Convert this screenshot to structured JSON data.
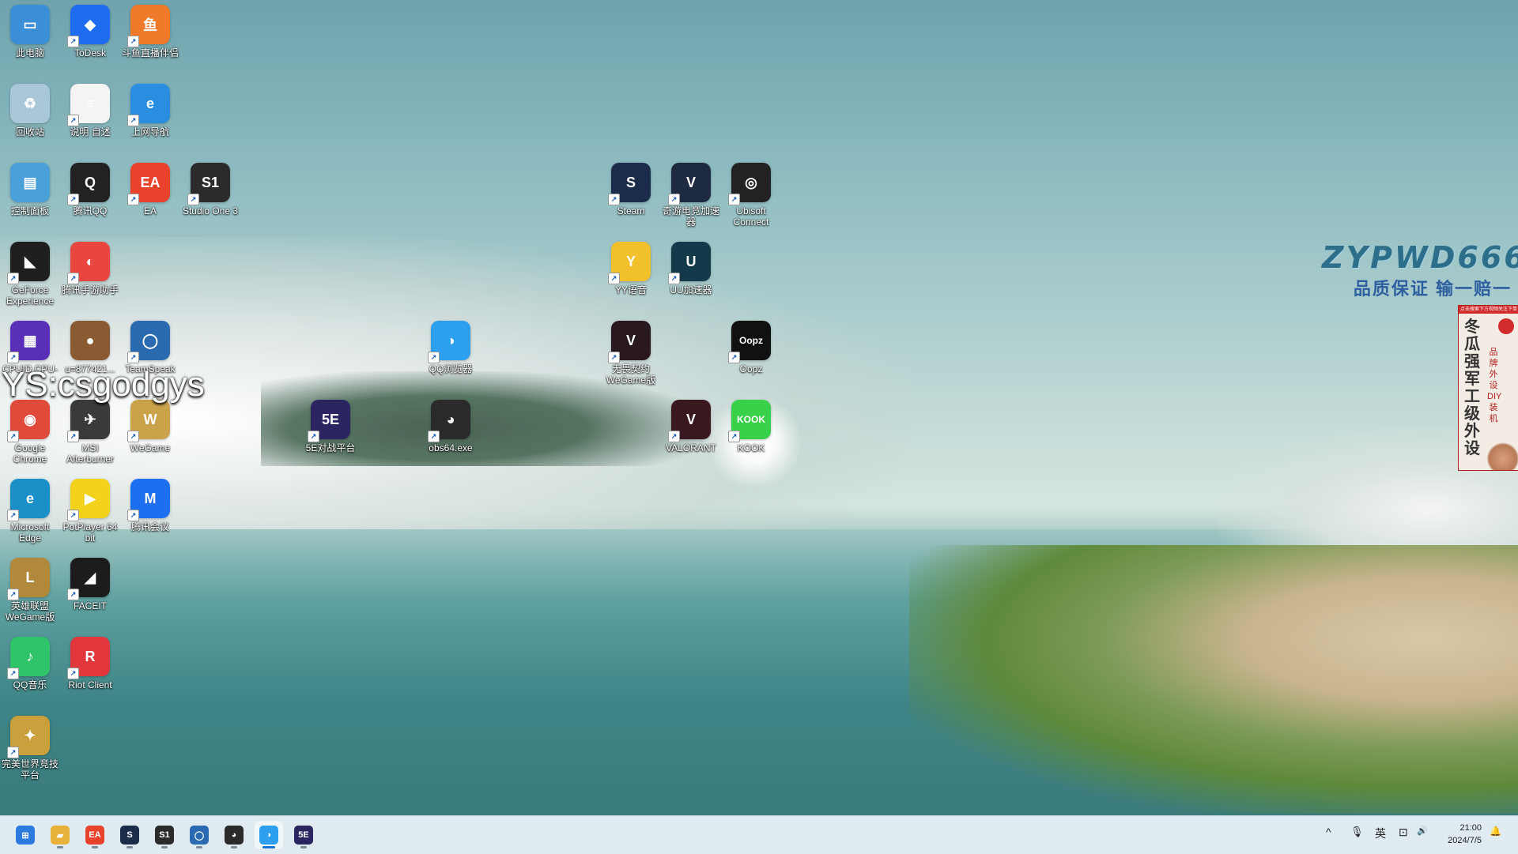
{
  "desktop": {
    "icons": [
      {
        "id": "this-pc",
        "label": "此电脑",
        "glyph": "▭",
        "bg": "#3a8fd6",
        "shortcut": false
      },
      {
        "id": "todesk",
        "label": "ToDesk",
        "glyph": "◆",
        "bg": "#1e6cf0",
        "shortcut": true
      },
      {
        "id": "douyu-assistant",
        "label": "斗鱼直播伴侣",
        "glyph": "鱼",
        "bg": "#f07a2a",
        "shortcut": true
      },
      {
        "id": "recycle-bin",
        "label": "回收站",
        "glyph": "♻",
        "bg": "#a9c7d8",
        "shortcut": false
      },
      {
        "id": "readme",
        "label": "说明 自述",
        "glyph": "≡",
        "bg": "#f4f4f4",
        "shortcut": true
      },
      {
        "id": "web-navigation",
        "label": "上网导航",
        "glyph": "e",
        "bg": "#2a8ee0",
        "shortcut": true
      },
      {
        "id": "control-panel",
        "label": "控制面板",
        "glyph": "▤",
        "bg": "#4aa0d8",
        "shortcut": false
      },
      {
        "id": "tencent-qq",
        "label": "腾讯QQ",
        "glyph": "Q",
        "bg": "#222222",
        "shortcut": true
      },
      {
        "id": "ea",
        "label": "EA",
        "glyph": "EA",
        "bg": "#e8412c",
        "shortcut": true
      },
      {
        "id": "studio-one",
        "label": "Studio One 3",
        "glyph": "S1",
        "bg": "#2b2b2b",
        "shortcut": true
      },
      {
        "id": "geforce-experience",
        "label": "GeForce Experience",
        "glyph": "◣",
        "bg": "#1f1f1f",
        "shortcut": true
      },
      {
        "id": "tencent-mobile-assistant",
        "label": "腾讯手游助手",
        "glyph": "◐",
        "bg": "#e94640",
        "shortcut": true
      },
      {
        "id": "cpuid",
        "label": "CPUID CPU-Z",
        "glyph": "▦",
        "bg": "#5a2fb8",
        "shortcut": true
      },
      {
        "id": "u-file",
        "label": "u=877421...",
        "glyph": "●",
        "bg": "#8a5a32",
        "shortcut": false
      },
      {
        "id": "teamspeak",
        "label": "TeamSpeak",
        "glyph": "◯",
        "bg": "#2a6ab0",
        "shortcut": true
      },
      {
        "id": "google-chrome",
        "label": "Google Chrome",
        "glyph": "◉",
        "bg": "#e04a3a",
        "shortcut": true
      },
      {
        "id": "msi-afterburner",
        "label": "MSI Afterburner",
        "glyph": "✈",
        "bg": "#3a3a3a",
        "shortcut": true
      },
      {
        "id": "wegame",
        "label": "WeGame",
        "glyph": "W",
        "bg": "#c9a24a",
        "shortcut": true
      },
      {
        "id": "microsoft-edge",
        "label": "Microsoft Edge",
        "glyph": "e",
        "bg": "#1a8fc8",
        "shortcut": true
      },
      {
        "id": "potplayer",
        "label": "PotPlayer 64 bit",
        "glyph": "▶",
        "bg": "#f2d21a",
        "shortcut": true
      },
      {
        "id": "tencent-meeting",
        "label": "腾讯会议",
        "glyph": "M",
        "bg": "#1d6ff0",
        "shortcut": true
      },
      {
        "id": "league-wegame",
        "label": "英雄联盟WeGame版",
        "glyph": "L",
        "bg": "#b08a3a",
        "shortcut": true
      },
      {
        "id": "faceit",
        "label": "FACEIT",
        "glyph": "◢",
        "bg": "#1c1c1c",
        "shortcut": true
      },
      {
        "id": "qq-music",
        "label": "QQ音乐",
        "glyph": "♪",
        "bg": "#2fc36a",
        "shortcut": true
      },
      {
        "id": "riot-client",
        "label": "Riot Client",
        "glyph": "R",
        "bg": "#e0363c",
        "shortcut": true
      },
      {
        "id": "perfect-world",
        "label": "完美世界竞技平台",
        "glyph": "✦",
        "bg": "#c9a03c",
        "shortcut": true
      },
      {
        "id": "qq-browser",
        "label": "QQ浏览器",
        "glyph": "◑",
        "bg": "#2ca0ee",
        "shortcut": true
      },
      {
        "id": "5e-platform",
        "label": "5E对战平台",
        "glyph": "5E",
        "bg": "#2a2560",
        "shortcut": true
      },
      {
        "id": "obs",
        "label": "obs64.exe",
        "glyph": "◕",
        "bg": "#2a2a2a",
        "shortcut": true
      },
      {
        "id": "steam",
        "label": "Steam",
        "glyph": "S",
        "bg": "#1a2c4a",
        "shortcut": true
      },
      {
        "id": "qiyou-accelerator",
        "label": "奇游电竞加速器",
        "glyph": "V",
        "bg": "#1d2a3f",
        "shortcut": true
      },
      {
        "id": "ubisoft-connect",
        "label": "Ubisoft Connect",
        "glyph": "◎",
        "bg": "#222222",
        "shortcut": true
      },
      {
        "id": "yy-voice",
        "label": "YY语音",
        "glyph": "Y",
        "bg": "#f2c02a",
        "shortcut": true
      },
      {
        "id": "uu-accelerator",
        "label": "UU加速器",
        "glyph": "U",
        "bg": "#123a4a",
        "shortcut": true
      },
      {
        "id": "valorant-wegame",
        "label": "无畏契约WeGame版",
        "glyph": "V",
        "bg": "#2a1820",
        "shortcut": true
      },
      {
        "id": "oopz",
        "label": "Oopz",
        "glyph": "Oopz",
        "bg": "#111111",
        "shortcut": true
      },
      {
        "id": "valorant",
        "label": "VALORANT",
        "glyph": "V",
        "bg": "#3a1820",
        "shortcut": true
      },
      {
        "id": "kook",
        "label": "KOOK",
        "glyph": "KOOK",
        "bg": "#3ad14a",
        "shortcut": true
      }
    ],
    "overlay_text": "YS:csgodgys",
    "watermark": {
      "title": "ZYPWD666",
      "subtitle": "品质保证  输一赔一"
    },
    "ad_banner": {
      "top_text": "点击搜索下方视频关注下单",
      "main_text": "冬瓜强军工级外设",
      "side_text": "品牌外设DIY装机"
    }
  },
  "taskbar": {
    "apps": [
      {
        "id": "start",
        "glyph": "⊞",
        "bg": "#2a7ae0",
        "active": false
      },
      {
        "id": "file-explorer",
        "glyph": "▰",
        "bg": "#e8b23a",
        "active": false
      },
      {
        "id": "ea",
        "glyph": "EA",
        "bg": "#e8412c",
        "active": false
      },
      {
        "id": "steam",
        "glyph": "S",
        "bg": "#1a2c4a",
        "active": false
      },
      {
        "id": "studio-one",
        "glyph": "S1",
        "bg": "#2b2b2b",
        "active": false
      },
      {
        "id": "teamspeak",
        "glyph": "◯",
        "bg": "#2a6ab0",
        "active": false
      },
      {
        "id": "obs",
        "glyph": "◕",
        "bg": "#2a2a2a",
        "active": false
      },
      {
        "id": "qq-browser",
        "glyph": "◑",
        "bg": "#2ca0ee",
        "active": true
      },
      {
        "id": "5e-platform",
        "glyph": "5E",
        "bg": "#2a2560",
        "active": false
      }
    ],
    "tray": {
      "chevron": "^",
      "mic": "🎙",
      "ime": "英",
      "network": "⊡",
      "volume": "🔊",
      "time": "21:00",
      "date": "2024/7/5",
      "notification": "🔔"
    }
  }
}
